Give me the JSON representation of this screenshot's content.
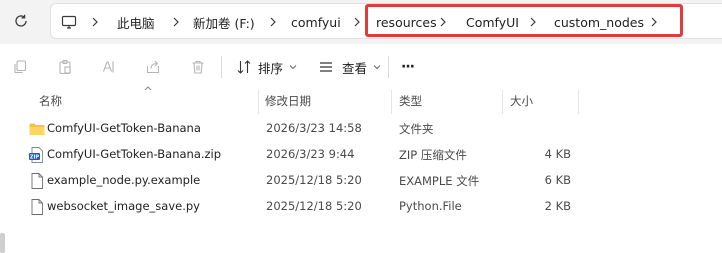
{
  "address": {
    "breadcrumb": [
      "此电脑",
      "新加卷 (F:)",
      "comfyui",
      "resources",
      "ComfyUI",
      "custom_nodes"
    ],
    "highlight_color": "#e23b3b"
  },
  "toolbar": {
    "icons": [
      "copy-icon",
      "paste-icon",
      "rename-icon",
      "share-icon",
      "delete-icon"
    ],
    "sort_label": "排序",
    "view_label": "查看",
    "more_label": "···"
  },
  "columns": {
    "name": "名称",
    "modified": "修改日期",
    "type": "类型",
    "size": "大小"
  },
  "files": [
    {
      "icon": "folder-icon",
      "name": "ComfyUI-GetToken-Banana",
      "modified": "2026/3/23 14:58",
      "type": "文件夹",
      "size": ""
    },
    {
      "icon": "zip-icon",
      "name": "ComfyUI-GetToken-Banana.zip",
      "modified": "2026/3/23 9:44",
      "type": "ZIP 压缩文件",
      "size": "4 KB"
    },
    {
      "icon": "file-icon",
      "name": "example_node.py.example",
      "modified": "2025/12/18 5:20",
      "type": "EXAMPLE 文件",
      "size": "6 KB"
    },
    {
      "icon": "file-icon",
      "name": "websocket_image_save.py",
      "modified": "2025/12/18 5:20",
      "type": "Python.File",
      "size": "2 KB"
    }
  ]
}
